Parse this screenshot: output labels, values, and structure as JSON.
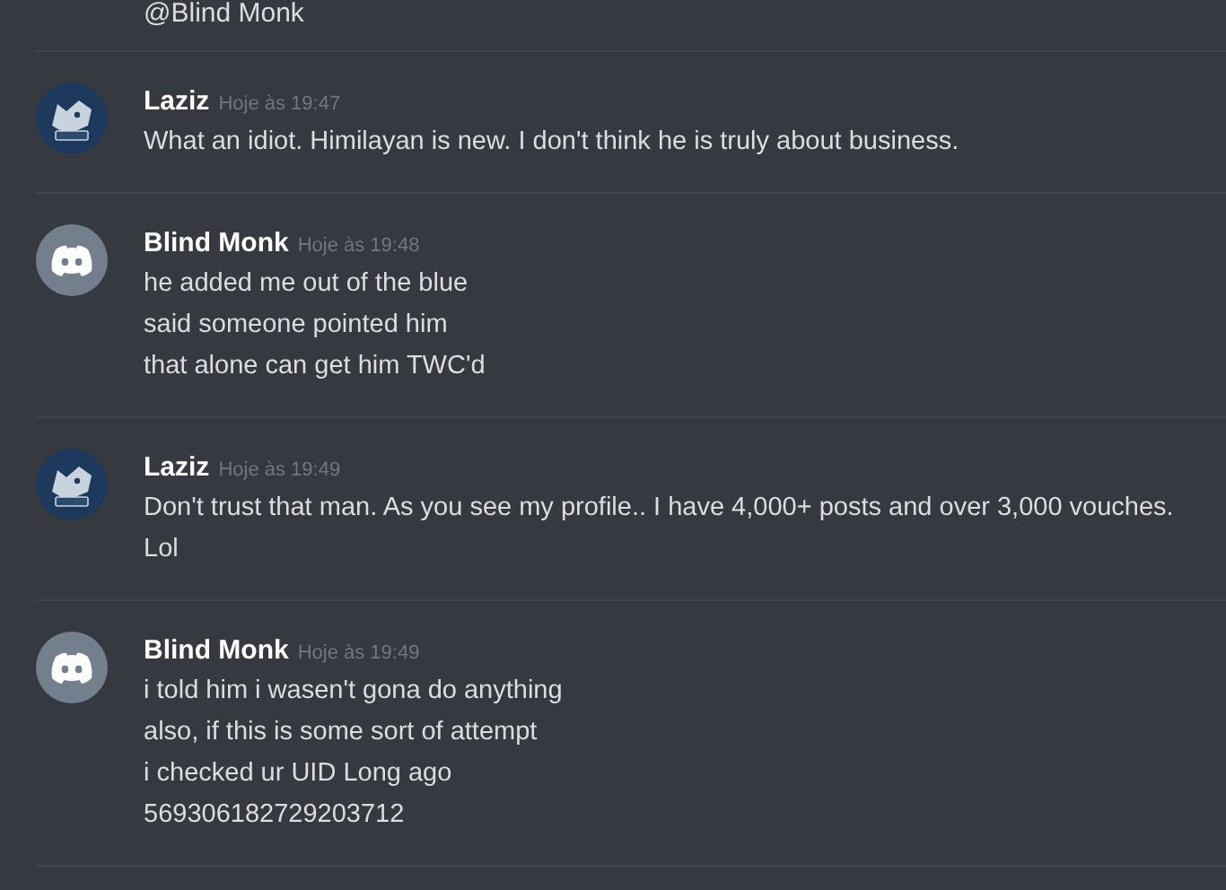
{
  "top_fragment": "@Blind Monk",
  "messages": [
    {
      "author": "Laziz",
      "timestamp": "Hoje às 19:47",
      "kind": "image",
      "lines": [
        "What an idiot. Himilayan is new. I don't think he is truly about business."
      ]
    },
    {
      "author": "Blind Monk",
      "timestamp": "Hoje às 19:48",
      "kind": "default",
      "lines": [
        "he added me out of the blue",
        "said someone pointed him",
        "that alone can get him TWC'd"
      ]
    },
    {
      "author": "Laziz",
      "timestamp": "Hoje às 19:49",
      "kind": "image",
      "lines": [
        "Don't trust that man. As you see my profile.. I have 4,000+ posts and over 3,000 vouches.",
        "Lol"
      ]
    },
    {
      "author": "Blind Monk",
      "timestamp": "Hoje às 19:49",
      "kind": "default",
      "lines": [
        "i told him i wasen't gona do anything",
        "also, if this is some sort of attempt",
        "i checked ur UID Long ago",
        "569306182729203712"
      ]
    }
  ]
}
